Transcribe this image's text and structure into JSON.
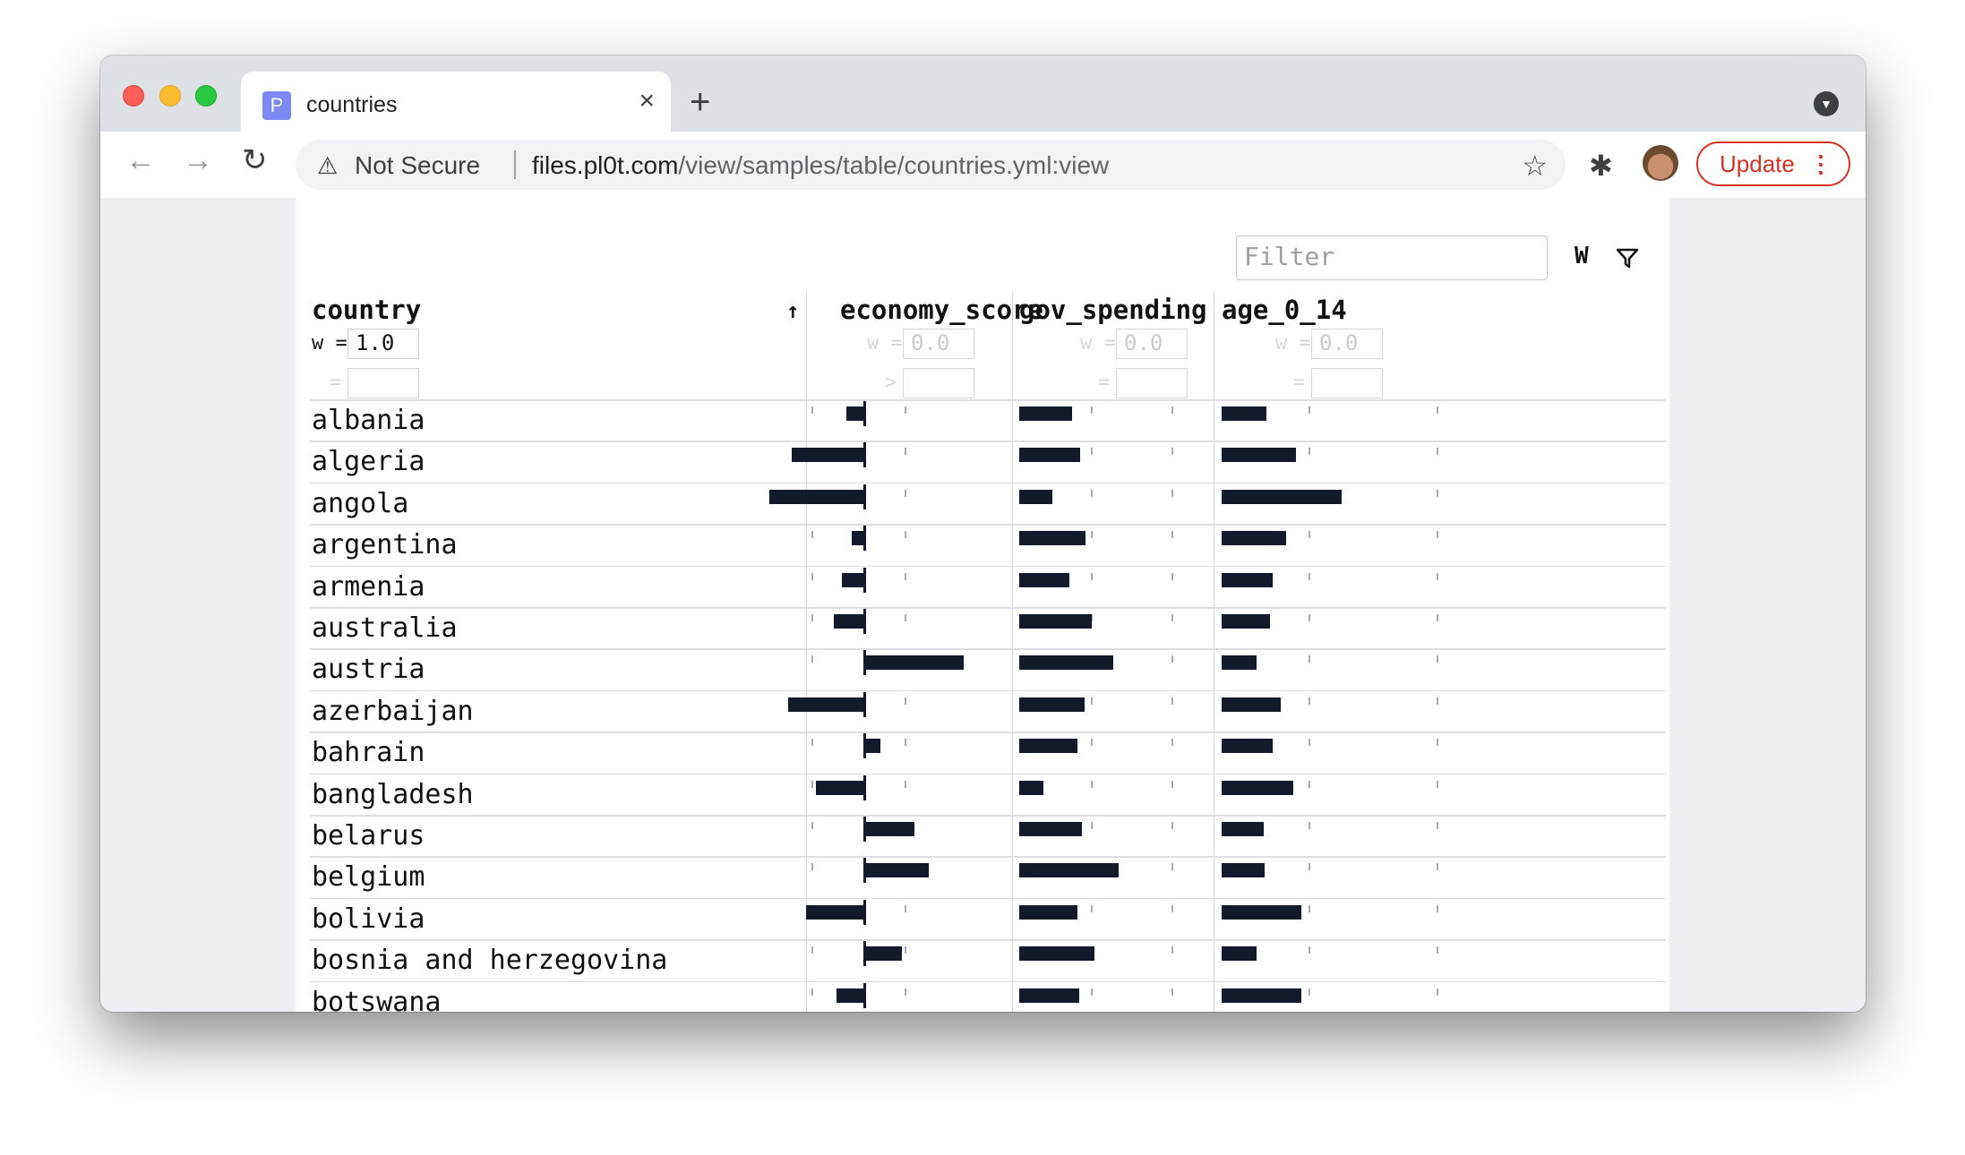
{
  "browser": {
    "tab_title": "countries",
    "favicon_letter": "P",
    "tab_close": "×",
    "new_tab": "+",
    "security_label": "Not Secure",
    "url_host": "files.pl0t.com",
    "url_path": "/view/samples/table/countries.yml:view",
    "update_label": "Update"
  },
  "toolbar": {
    "filter_placeholder": "Filter",
    "weight_toggle": "W"
  },
  "table": {
    "sort_indicator": "↑",
    "columns": [
      {
        "name": "country",
        "weight_label": "w =",
        "weight_value": "1.0",
        "filter_op": "=",
        "active": true
      },
      {
        "name": "economy_score",
        "weight_label": "w =",
        "weight_value": "0.0",
        "filter_op": ">",
        "active": false
      },
      {
        "name": "gov_spending",
        "weight_label": "w =",
        "weight_value": "0.0",
        "filter_op": "=",
        "active": false
      },
      {
        "name": "age_0_14",
        "weight_label": "w =",
        "weight_value": "0.0",
        "filter_op": "=",
        "active": false
      }
    ],
    "rows": [
      {
        "country": "albania",
        "economy_score": -0.19,
        "gov_spending": 0.4,
        "age_0_14": 0.34
      },
      {
        "country": "algeria",
        "economy_score": -0.76,
        "gov_spending": 0.46,
        "age_0_14": 0.57
      },
      {
        "country": "angola",
        "economy_score": -1.0,
        "gov_spending": 0.25,
        "age_0_14": 0.92
      },
      {
        "country": "argentina",
        "economy_score": -0.13,
        "gov_spending": 0.5,
        "age_0_14": 0.49
      },
      {
        "country": "armenia",
        "economy_score": -0.24,
        "gov_spending": 0.38,
        "age_0_14": 0.39
      },
      {
        "country": "australia",
        "economy_score": -0.32,
        "gov_spending": 0.55,
        "age_0_14": 0.37
      },
      {
        "country": "austria",
        "economy_score": 1.05,
        "gov_spending": 0.71,
        "age_0_14": 0.27
      },
      {
        "country": "azerbaijan",
        "economy_score": -0.8,
        "gov_spending": 0.49,
        "age_0_14": 0.45
      },
      {
        "country": "bahrain",
        "economy_score": 0.17,
        "gov_spending": 0.44,
        "age_0_14": 0.39
      },
      {
        "country": "bangladesh",
        "economy_score": -0.51,
        "gov_spending": 0.18,
        "age_0_14": 0.55
      },
      {
        "country": "belarus",
        "economy_score": 0.53,
        "gov_spending": 0.47,
        "age_0_14": 0.32
      },
      {
        "country": "belgium",
        "economy_score": 0.68,
        "gov_spending": 0.75,
        "age_0_14": 0.33
      },
      {
        "country": "bolivia",
        "economy_score": -0.61,
        "gov_spending": 0.44,
        "age_0_14": 0.61
      },
      {
        "country": "bosnia and herzegovina",
        "economy_score": 0.4,
        "gov_spending": 0.57,
        "age_0_14": 0.27
      },
      {
        "country": "botswana",
        "economy_score": -0.29,
        "gov_spending": 0.45,
        "age_0_14": 0.61
      }
    ]
  },
  "colors": {
    "bar": "#131a2b",
    "update": "#d93025"
  }
}
